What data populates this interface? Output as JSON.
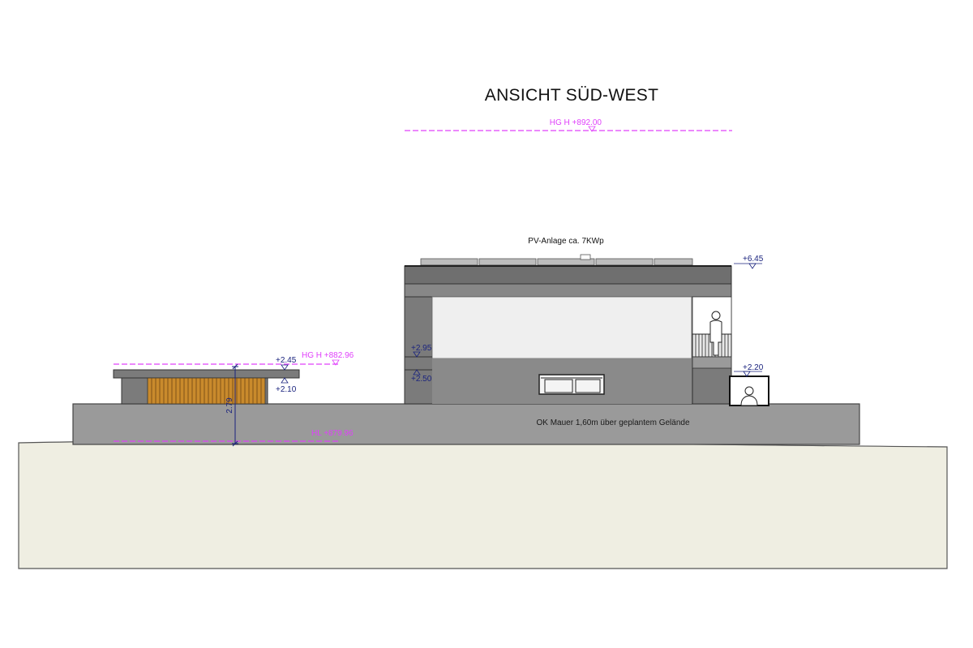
{
  "title": "ANSICHT SÜD-WEST",
  "colors": {
    "accent_magenta": "#e040fb",
    "level_blue": "#1a237e",
    "terrain_fill": "#efeee2",
    "wall_grey": "#9a9a9a",
    "building_dark": "#7b7b7b",
    "building_light": "#efefef",
    "wood_slats": "#c98a2c"
  },
  "labels": {
    "ridge_height": "HG H  +892.00",
    "carport_height": "HG H  +882.96",
    "ground_height": "HL +879.96",
    "pv_note": "PV-Anlage ca. 7KWp",
    "wall_note": "OK Mauer 1,60m über geplantem Gelände",
    "carport_dimension": "2.79"
  },
  "levels": {
    "roof_top": "+6.45",
    "upper_band": "+2.95",
    "lower_band": "+2.50",
    "entrance": "+2.20",
    "carport_top": "+2.45",
    "carport_under": "+2.10"
  },
  "icons": {
    "person_balcony": "person-figure-icon",
    "person_entrance": "person-figure-icon",
    "level_marker": "triangle-down-icon"
  }
}
